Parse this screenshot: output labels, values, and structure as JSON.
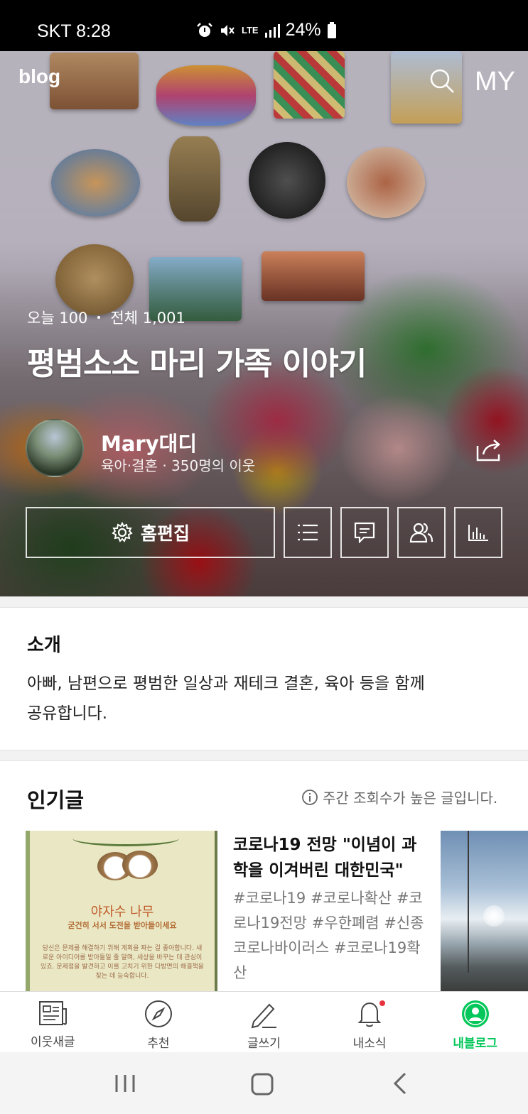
{
  "status_bar": {
    "carrier_time": "SKT 8:28",
    "network": "LTE",
    "battery": "24%",
    "icons": [
      "alarm-icon",
      "mute-icon",
      "lte-icon",
      "signal-icon",
      "battery-icon"
    ]
  },
  "header": {
    "logo": "blog",
    "search_icon": "search-icon",
    "my_label": "MY"
  },
  "blog": {
    "stats_today": "오늘 100",
    "stats_total": "전체 1,001",
    "title": "평범소소 마리 가족 이야기",
    "nickname": "Mary대디",
    "meta": "육아·결혼 · 350명의 이웃",
    "edit_label": "홈편집",
    "action_icons": [
      "list-icon",
      "comment-icon",
      "neighbors-icon",
      "stats-icon"
    ]
  },
  "intro": {
    "heading": "소개",
    "text_line1": "아빠, 남편으로 평범한 일상과 재테크 결혼, 육아 등을 함께",
    "text_line2": "공유합니다."
  },
  "popular": {
    "heading": "인기글",
    "note": "주간 조회수가 높은 글입니다.",
    "card_image": {
      "title": "야자수 나무",
      "subtitle": "굳건히 서서 도전을 받아들이세요",
      "body": "당신은 문제를 해결하기 위해 계획을 짜는 걸 좋아합니다. 새로운 아이디어를 받아들일 줄 알며, 세상을 바꾸는 데 관심이 있죠. 문제점을 발견하고 이를 고치기 위한 다방면의 해결책을 찾는 데 능숙합니다."
    },
    "post": {
      "title": "코로나19 전망 \"이념이 과학을 이겨버린 대한민국\"",
      "tags": "#코로나19 #코로나확산 #코로나19전망 #우한폐렴 #신종코로나바이러스 #코로나19확산"
    }
  },
  "bottom_nav": {
    "items": [
      {
        "label": "이웃새글",
        "icon": "feed-icon"
      },
      {
        "label": "추천",
        "icon": "compass-icon"
      },
      {
        "label": "글쓰기",
        "icon": "pencil-icon"
      },
      {
        "label": "내소식",
        "icon": "bell-icon"
      },
      {
        "label": "내블로그",
        "icon": "profile-icon"
      }
    ],
    "active_index": 4
  },
  "colors": {
    "accent": "#03c75a",
    "badge": "#e8323c",
    "status_bar": "#000000"
  }
}
